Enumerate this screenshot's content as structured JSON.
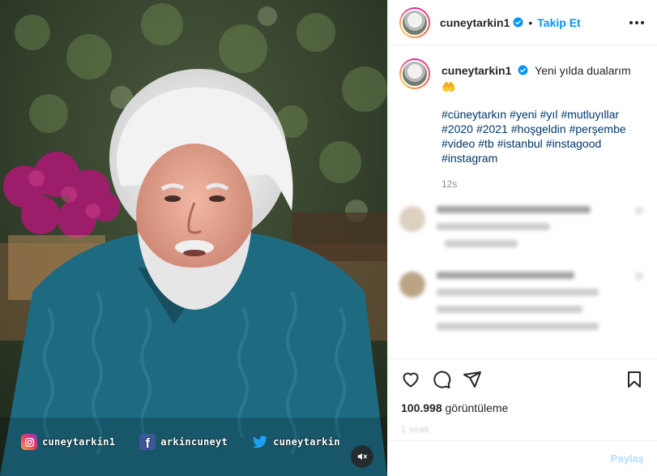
{
  "video": {
    "overlay": {
      "instagram_handle": "cuneytarkin1",
      "facebook_handle": "arkincuneyt",
      "twitter_handle": "cuneytarkin"
    },
    "mute_icon": "speaker-muted-icon"
  },
  "post": {
    "username": "cuneytarkin1",
    "verified": true,
    "follow_label": "Takip Et",
    "separator": "•",
    "caption": {
      "username": "cuneytarkin1",
      "text": "Yeni yılda dualarım",
      "emoji": "🤲",
      "hashtags": [
        "#cüneytarkın",
        "#yeni",
        "#yıl",
        "#mutluyıllar",
        "#2020",
        "#2021",
        "#hoşgeldin",
        "#perşembe",
        "#video",
        "#tb",
        "#istanbul",
        "#instagood",
        "#instagram"
      ],
      "time": "12s"
    },
    "views_count": "100.998",
    "views_label": "görüntüleme",
    "date": "1 ocak",
    "add_comment_placeholder": "",
    "share_label": "Paylaş"
  },
  "colors": {
    "accent": "#0095f6",
    "hashtag": "#00376b",
    "muted": "#8e8e8e",
    "share_disabled": "#b2dffc"
  }
}
